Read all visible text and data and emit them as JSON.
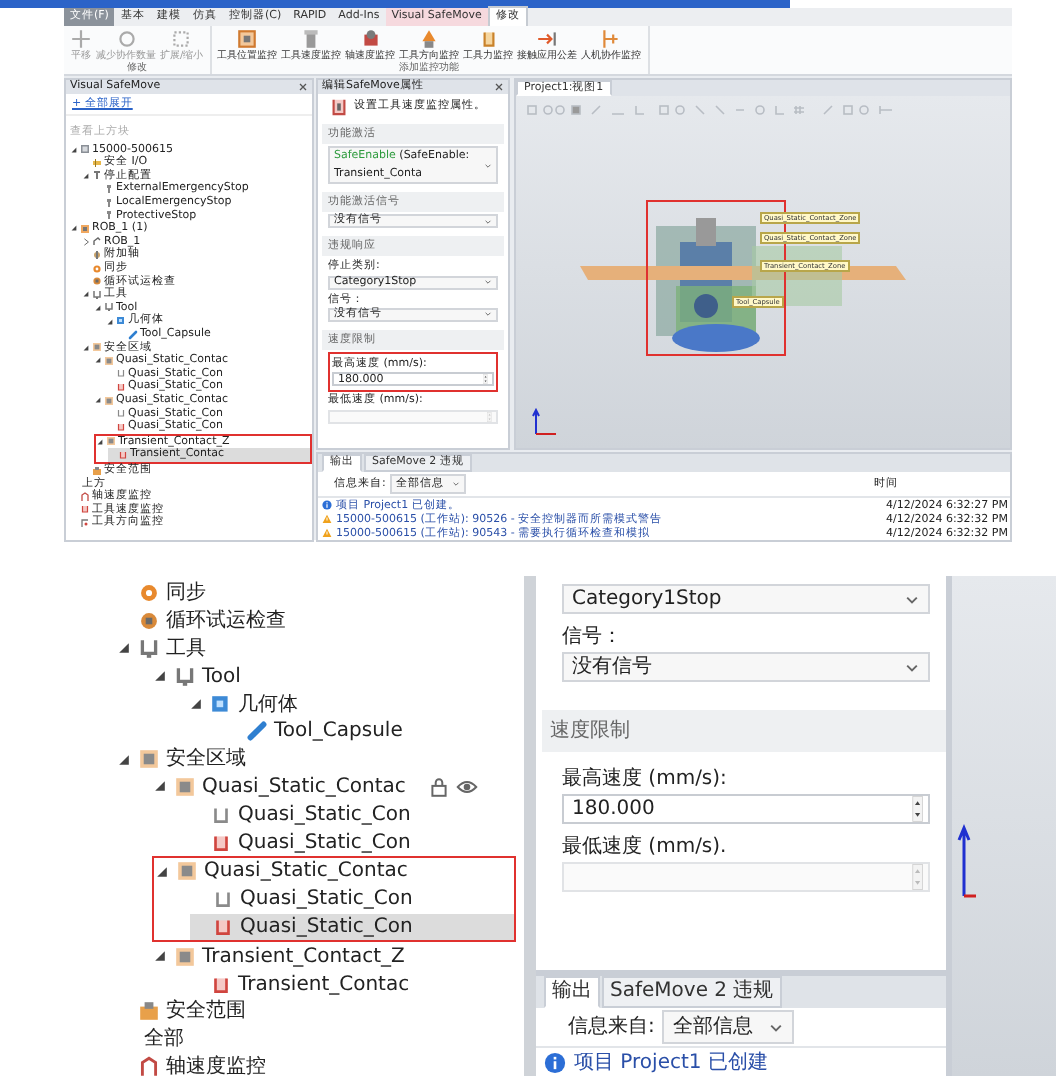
{
  "overview": {
    "ribbon_tabs": [
      {
        "label": "文件(F)",
        "kind": "menu",
        "selected": false
      },
      {
        "label": "基本",
        "kind": "tab",
        "selected": false
      },
      {
        "label": "建模",
        "kind": "tab",
        "selected": false
      },
      {
        "label": "仿真",
        "kind": "tab",
        "selected": false
      },
      {
        "label": "控制器(C)",
        "kind": "tab",
        "selected": false
      },
      {
        "label": "RAPID",
        "kind": "tab",
        "selected": false
      },
      {
        "label": "Add-Ins",
        "kind": "tab",
        "selected": false
      },
      {
        "label": "Visual SafeMove",
        "kind": "contextual",
        "selected": false
      },
      {
        "label": "修改",
        "kind": "tab",
        "selected": true
      }
    ],
    "ribbon_groups": [
      {
        "label": "修改",
        "buttons": [
          {
            "label": "平移",
            "disabled": true
          },
          {
            "label": "减少协作数量",
            "disabled": true
          },
          {
            "label": "扩展/缩小",
            "disabled": true
          }
        ]
      },
      {
        "label": "添加监控功能",
        "buttons": [
          {
            "label": "工具位置监控",
            "disabled": false
          },
          {
            "label": "工具速度监控",
            "disabled": false
          },
          {
            "label": "轴速度监控",
            "disabled": false
          },
          {
            "label": "工具方向监控",
            "disabled": false
          },
          {
            "label": "工具力监控",
            "disabled": false
          },
          {
            "label": "接触应用公差",
            "disabled": false
          },
          {
            "label": "人机协作监控",
            "disabled": false
          }
        ]
      }
    ],
    "tree_panel": {
      "title": "Visual SafeMove",
      "expand_all": "+ 全部展开",
      "hint": "查看上方块",
      "tree": [
        {
          "label": "15000-500615",
          "kind": "controller",
          "expanded": true,
          "selected": false,
          "children": [
            {
              "label": "安全 I/O",
              "kind": "io",
              "selected": false
            },
            {
              "label": "停止配置",
              "kind": "stop",
              "expanded": true,
              "selected": false,
              "children": [
                {
                  "label": "ExternalEmergencyStop",
                  "kind": "signal",
                  "selected": false
                },
                {
                  "label": "LocalEmergencyStop",
                  "kind": "signal",
                  "selected": false
                },
                {
                  "label": "ProtectiveStop",
                  "kind": "signal",
                  "selected": false
                }
              ]
            }
          ]
        },
        {
          "label": "ROB_1 (1)",
          "kind": "robot",
          "expanded": true,
          "selected": false,
          "children": [
            {
              "label": "ROB_1",
              "kind": "arm",
              "expanded": false,
              "selected": false
            },
            {
              "label": "附加轴",
              "kind": "axisgroup",
              "selected": false
            },
            {
              "label": "同步",
              "kind": "sync",
              "selected": false
            },
            {
              "label": "循环试运检查",
              "kind": "cycle",
              "selected": false
            },
            {
              "label": "工具",
              "kind": "tool",
              "expanded": true,
              "selected": false,
              "children": [
                {
                  "label": "Tool",
                  "kind": "tool",
                  "expanded": true,
                  "selected": false,
                  "children": [
                    {
                      "label": "几何体",
                      "kind": "geometry",
                      "expanded": true,
                      "selected": false,
                      "children": [
                        {
                          "label": "Tool_Capsule",
                          "kind": "capsule",
                          "selected": false
                        }
                      ]
                    }
                  ]
                }
              ]
            },
            {
              "label": "安全区域",
              "kind": "zone",
              "expanded": true,
              "selected": false,
              "children": [
                {
                  "label": "Quasi_Static_Contac",
                  "kind": "zone",
                  "expanded": true,
                  "selected": false,
                  "children": [
                    {
                      "label": "Quasi_Static_Con",
                      "kind": "static",
                      "selected": false
                    },
                    {
                      "label": "Quasi_Static_Con",
                      "kind": "contact",
                      "selected": false
                    }
                  ]
                },
                {
                  "label": "Quasi_Static_Contac",
                  "kind": "zone",
                  "expanded": true,
                  "selected": false,
                  "children": [
                    {
                      "label": "Quasi_Static_Con",
                      "kind": "static",
                      "selected": false
                    },
                    {
                      "label": "Quasi_Static_Con",
                      "kind": "contact",
                      "selected": false
                    }
                  ]
                },
                {
                  "label": "Transient_Contact_Z",
                  "kind": "zone",
                  "expanded": true,
                  "selected": false,
                  "marked": true,
                  "children": [
                    {
                      "label": "Transient_Contac",
                      "kind": "contact",
                      "selected": true
                    }
                  ]
                }
              ]
            },
            {
              "label": "安全范围",
              "kind": "range",
              "selected": false
            }
          ]
        },
        {
          "label": "上方",
          "kind": "none",
          "selected": false
        },
        {
          "label": "轴速度监控",
          "kind": "axisspeed",
          "selected": false
        },
        {
          "label": "工具速度监控",
          "kind": "contact",
          "selected": false
        },
        {
          "label": "工具方向监控",
          "kind": "orient",
          "selected": false
        }
      ]
    },
    "props_panel": {
      "title": "编辑SafeMove属性",
      "description": "设置工具速度监控属性。",
      "sections": [
        {
          "heading": "功能激活",
          "fields": [
            {
              "kind": "select",
              "tag": "SafeEnable",
              "value": "(SafeEnable: Transient_Conta",
              "highlighted": false
            }
          ]
        },
        {
          "heading": "功能激活信号",
          "fields": [
            {
              "kind": "select",
              "value": "没有信号",
              "highlighted": false
            }
          ]
        },
        {
          "heading": "违规响应",
          "fields": [
            {
              "kind": "select",
              "label": "停止类别:",
              "value": "Category1Stop",
              "highlighted": false
            },
            {
              "kind": "select",
              "label": "信号：",
              "value": "没有信号",
              "highlighted": false
            }
          ]
        },
        {
          "heading": "速度限制",
          "fields": [
            {
              "kind": "number",
              "label": "最高速度 (mm/s):",
              "value": "180.000",
              "disabled": false,
              "highlighted": true
            },
            {
              "kind": "number",
              "label": "最低速度 (mm/s):",
              "disabled": true,
              "highlighted": false
            }
          ]
        }
      ]
    },
    "view": {
      "tab": "Project1:视图1",
      "labels": [
        "Quasi_Static_Contact_Zone",
        "Quasi_Static_Contact_Zone",
        "Transient_Contact_Zone",
        "Tool_Capsule"
      ],
      "marked": true
    },
    "output": {
      "tabs": [
        {
          "label": "输出",
          "selected": true
        },
        {
          "label": "SafeMove 2 违规",
          "selected": false
        }
      ],
      "filter_label": "信息来自:",
      "filter": "全部信息",
      "time_header": "时间",
      "rows": [
        {
          "kind": "info",
          "message": "项目 Project1 已创建。",
          "time": "4/12/2024 6:32:27 PM"
        },
        {
          "kind": "warning",
          "message": "15000-500615 (工作站): 90526 - 安全控制器而所需模式警告",
          "time": "4/12/2024 6:32:32 PM"
        },
        {
          "kind": "warning",
          "message": "15000-500615 (工作站): 90543 - 需要执行循环检查和模拟",
          "time": "4/12/2024 6:32:32 PM"
        }
      ]
    }
  },
  "tree_detail": [
    {
      "label": "同步",
      "kind": "sync",
      "selected": false
    },
    {
      "label": "循环试运检查",
      "kind": "cycle",
      "selected": false
    },
    {
      "label": "工具",
      "kind": "tool",
      "expanded": true,
      "selected": false,
      "children": [
        {
          "label": "Tool",
          "kind": "tool",
          "expanded": true,
          "selected": false,
          "children": [
            {
              "label": "几何体",
              "kind": "geometry",
              "expanded": true,
              "selected": false,
              "children": [
                {
                  "label": "Tool_Capsule",
                  "kind": "capsule",
                  "selected": false
                }
              ]
            }
          ]
        }
      ]
    },
    {
      "label": "安全区域",
      "kind": "zone",
      "expanded": true,
      "selected": false,
      "children": [
        {
          "label": "Quasi_Static_Contac",
          "kind": "zone",
          "expanded": true,
          "selected": false,
          "lock_eye": true,
          "children": [
            {
              "label": "Quasi_Static_Con",
              "kind": "static",
              "selected": false
            },
            {
              "label": "Quasi_Static_Con",
              "kind": "contact",
              "selected": false
            }
          ]
        },
        {
          "label": "Quasi_Static_Contac",
          "kind": "zone",
          "expanded": true,
          "selected": false,
          "marked": true,
          "children": [
            {
              "label": "Quasi_Static_Con",
              "kind": "static",
              "selected": false
            },
            {
              "label": "Quasi_Static_Con",
              "kind": "contact",
              "selected": true
            }
          ]
        },
        {
          "label": "Transient_Contact_Z",
          "kind": "zone",
          "expanded": true,
          "selected": false,
          "children": [
            {
              "label": "Transient_Contac",
              "kind": "contact",
              "selected": false
            }
          ]
        }
      ]
    },
    {
      "label": "安全范围",
      "kind": "range",
      "selected": false
    },
    {
      "label": "全部",
      "kind": "none",
      "selected": false
    },
    {
      "label": "轴速度监控",
      "kind": "axisspeed",
      "selected": false
    }
  ],
  "props_detail": {
    "sections": [
      {
        "fields": [
          {
            "kind": "select",
            "value": "Category1Stop",
            "highlighted": false
          },
          {
            "kind": "select",
            "label": "信号：",
            "value": "没有信号",
            "highlighted": false
          }
        ]
      },
      {
        "heading": "速度限制",
        "fields": [
          {
            "kind": "number",
            "label": "最高速度 (mm/s):",
            "value": "180.000",
            "disabled": false,
            "highlighted": false
          },
          {
            "kind": "number",
            "label": "最低速度 (mm/s).",
            "disabled": true,
            "highlighted": false
          }
        ]
      }
    ]
  },
  "output_detail": {
    "tabs": [
      {
        "label": "输出",
        "selected": true
      },
      {
        "label": "SafeMove 2 违规",
        "selected": false
      }
    ],
    "filter_label": "信息来自:",
    "filter": "全部信息",
    "rows": [
      {
        "kind": "info",
        "message": "项目 Project1 已创建"
      }
    ]
  }
}
